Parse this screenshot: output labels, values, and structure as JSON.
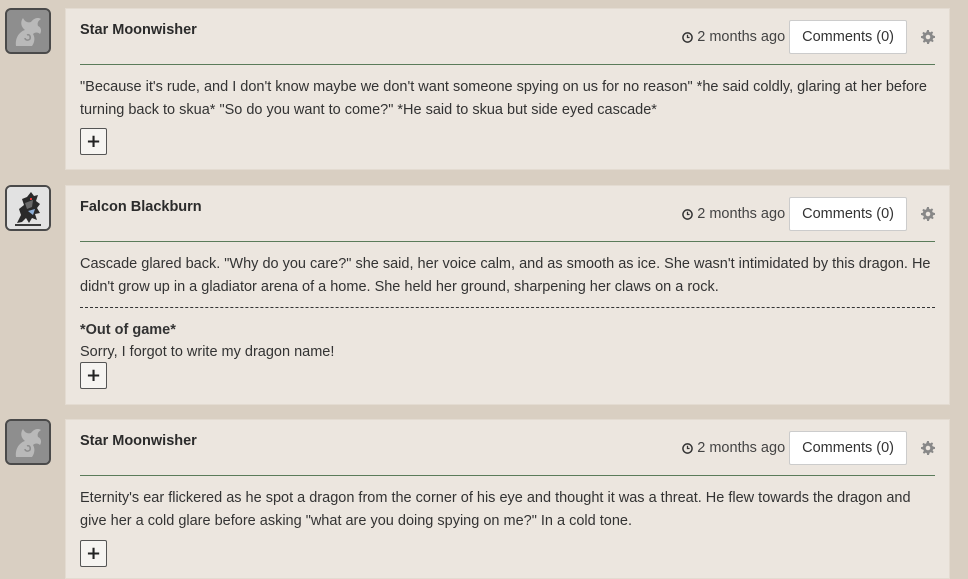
{
  "posts": [
    {
      "avatar": "dragon-silhouette-avatar",
      "author": "Star Moonwisher",
      "time": "2 months ago",
      "comments_label": "Comments (0)",
      "body": "\"Because it's rude, and I don't know maybe we don't want someone spying on us for no reason\" *he said coldly, glaring at her before turning back to skua* \"So do you want to come?\" *He said to skua but side eyed cascade*",
      "add_label": "+"
    },
    {
      "avatar": "dragon-pixel-avatar",
      "author": "Falcon Blackburn",
      "time": "2 months ago",
      "comments_label": "Comments (0)",
      "body": "Cascade glared back. \"Why do you care?\" she said, her voice calm, and as smooth as ice. She wasn't intimidated by this dragon. He didn't grow up in a gladiator arena of a home. She held her ground, sharpening her claws on a rock.",
      "ooc_title": "*Out of game*",
      "ooc_body": "Sorry, I forgot to write my dragon name!",
      "add_label": "+"
    },
    {
      "avatar": "dragon-silhouette-avatar",
      "author": "Star Moonwisher",
      "time": "2 months ago",
      "comments_label": "Comments (0)",
      "body": "Eternity's ear flickered as he spot a dragon from the corner of his eye and thought it was a threat. He flew towards the dragon and give her a cold glare before asking \"what are you doing spying on me?\" In a cold tone.",
      "add_label": "+"
    }
  ],
  "icons": {
    "clock": "clock-icon",
    "gear": "gear-icon"
  },
  "colors": {
    "page_bg": "#d9cfc2",
    "card_bg": "#ece6df",
    "divider": "#5a7b5a"
  }
}
